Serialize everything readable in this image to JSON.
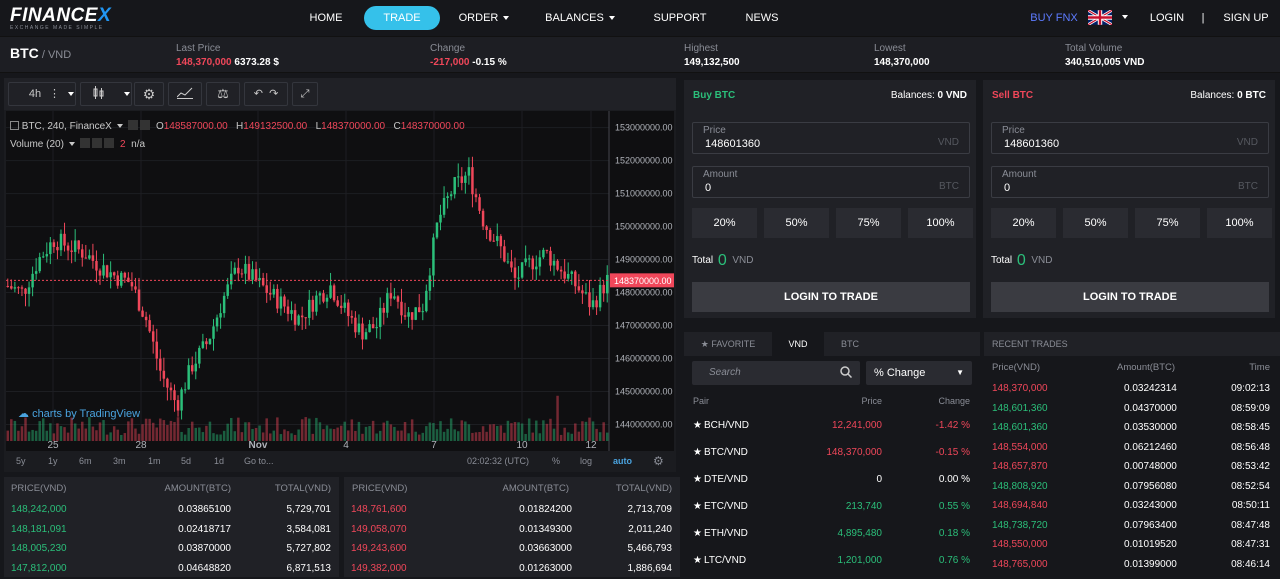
{
  "brand": {
    "name_a": "FINANCE",
    "name_b": "X",
    "tagline": "EXCHANGE MADE SIMPLE"
  },
  "nav": {
    "items": [
      "HOME",
      "TRADE",
      "ORDER",
      "BALANCES",
      "SUPPORT",
      "NEWS"
    ],
    "buy": "BUY FNX",
    "login": "LOGIN",
    "sep": "|",
    "signup": "SIGN UP"
  },
  "ticker": {
    "pair": "BTC",
    "quote": "/ VND",
    "last_label": "Last Price",
    "last_vnd": "148,370,000",
    "last_usd": "6373.28 $",
    "change_label": "Change",
    "change_abs": "-217,000",
    "change_pct": "-0.15 %",
    "high_label": "Highest",
    "high": "149,132,500",
    "low_label": "Lowest",
    "low": "148,370,000",
    "vol_label": "Total Volume",
    "vol": "340,510,005 VND"
  },
  "chart": {
    "interval": "4h",
    "legend": "BTC, 240, FinanceX",
    "o_lab": "O",
    "o": "148587000.00",
    "h_lab": "H",
    "h": "149132500.00",
    "l_lab": "L",
    "l": "148370000.00",
    "c_lab": "C",
    "c": "148370000.00",
    "volume": "Volume (20)",
    "vol_val": "2",
    "vol_na": "n/a",
    "current": "148370000.00",
    "watermark": "charts by TradingView",
    "yticks": [
      "153000000.00",
      "152000000.00",
      "151000000.00",
      "150000000.00",
      "149000000.00",
      "148000000.00",
      "147000000.00",
      "146000000.00",
      "145000000.00",
      "144000000.00"
    ],
    "xticks": [
      "25",
      "28",
      "Nov",
      "4",
      "7",
      "10",
      "12"
    ],
    "ranges": [
      "5y",
      "1y",
      "6m",
      "3m",
      "1m",
      "5d",
      "1d",
      "Go to..."
    ],
    "time": "02:02:32 (UTC)",
    "pct": "%",
    "log": "log",
    "auto": "auto"
  },
  "chart_data": {
    "type": "candlestick",
    "ylim": [
      143500000,
      153200000
    ],
    "x_ticks": [
      "25",
      "28",
      "Nov",
      "4",
      "7",
      "10",
      "12"
    ],
    "last": 148370000,
    "open": 148587000,
    "high": 149132500,
    "low": 148370000,
    "close": 148370000
  },
  "buy": {
    "title": "Buy BTC",
    "bal_label": "Balances:",
    "bal": "0 VND",
    "price_label": "Price",
    "price": "148601360",
    "price_unit": "VND",
    "amount_label": "Amount",
    "amount": "0",
    "amount_unit": "BTC",
    "pcts": [
      "20%",
      "50%",
      "75%",
      "100%"
    ],
    "total_label": "Total",
    "total": "0",
    "total_unit": "VND",
    "login": "LOGIN TO TRADE"
  },
  "sell": {
    "title": "Sell BTC",
    "bal_label": "Balances:",
    "bal": "0 BTC",
    "price_label": "Price",
    "price": "148601360",
    "price_unit": "VND",
    "amount_label": "Amount",
    "amount": "0",
    "amount_unit": "BTC",
    "pcts": [
      "20%",
      "50%",
      "75%",
      "100%"
    ],
    "total_label": "Total",
    "total": "0",
    "total_unit": "VND",
    "login": "LOGIN TO TRADE"
  },
  "market": {
    "tabs": [
      "FAVORITE",
      "VND",
      "BTC"
    ],
    "search_placeholder": "Search",
    "sort": "% Change",
    "cols": [
      "Pair",
      "Price",
      "Change"
    ],
    "rows": [
      {
        "pair": "BCH/VND",
        "price": "12,241,000",
        "change": "-1.42 %",
        "dir": "down"
      },
      {
        "pair": "BTC/VND",
        "price": "148,370,000",
        "change": "-0.15 %",
        "dir": "down"
      },
      {
        "pair": "DTE/VND",
        "price": "0",
        "change": "0.00 %",
        "dir": "flat"
      },
      {
        "pair": "ETC/VND",
        "price": "213,740",
        "change": "0.55 %",
        "dir": "up"
      },
      {
        "pair": "ETH/VND",
        "price": "4,895,480",
        "change": "0.18 %",
        "dir": "up"
      },
      {
        "pair": "LTC/VND",
        "price": "1,201,000",
        "change": "0.76 %",
        "dir": "up"
      }
    ]
  },
  "trades": {
    "title": "RECENT TRADES",
    "cols": [
      "Price(VND)",
      "Amount(BTC)",
      "Time"
    ],
    "rows": [
      {
        "p": "148,370,000",
        "a": "0.03242314",
        "t": "09:02:13",
        "d": "down"
      },
      {
        "p": "148,601,360",
        "a": "0.04370000",
        "t": "08:59:09",
        "d": "up"
      },
      {
        "p": "148,601,360",
        "a": "0.03530000",
        "t": "08:58:45",
        "d": "up"
      },
      {
        "p": "148,554,000",
        "a": "0.06212460",
        "t": "08:56:48",
        "d": "down"
      },
      {
        "p": "148,657,870",
        "a": "0.00748000",
        "t": "08:53:42",
        "d": "down"
      },
      {
        "p": "148,808,920",
        "a": "0.07956080",
        "t": "08:52:54",
        "d": "up"
      },
      {
        "p": "148,694,840",
        "a": "0.03243000",
        "t": "08:50:11",
        "d": "down"
      },
      {
        "p": "148,738,720",
        "a": "0.07963400",
        "t": "08:47:48",
        "d": "up"
      },
      {
        "p": "148,550,000",
        "a": "0.01019520",
        "t": "08:47:31",
        "d": "down"
      },
      {
        "p": "148,765,000",
        "a": "0.01399000",
        "t": "08:46:14",
        "d": "down"
      }
    ]
  },
  "bids": {
    "cols": [
      "PRICE(VND)",
      "AMOUNT(BTC)",
      "TOTAL(VND)"
    ],
    "rows": [
      {
        "p": "148,242,000",
        "a": "0.03865100",
        "t": "5,729,701"
      },
      {
        "p": "148,181,091",
        "a": "0.02418717",
        "t": "3,584,081"
      },
      {
        "p": "148,005,230",
        "a": "0.03870000",
        "t": "5,727,802"
      },
      {
        "p": "147,812,000",
        "a": "0.04648820",
        "t": "6,871,513"
      }
    ]
  },
  "asks": {
    "cols": [
      "PRICE(VND)",
      "AMOUNT(BTC)",
      "TOTAL(VND)"
    ],
    "rows": [
      {
        "p": "148,761,600",
        "a": "0.01824200",
        "t": "2,713,709"
      },
      {
        "p": "149,058,070",
        "a": "0.01349300",
        "t": "2,011,240"
      },
      {
        "p": "149,243,600",
        "a": "0.03663000",
        "t": "5,466,793"
      },
      {
        "p": "149,382,000",
        "a": "0.01263000",
        "t": "1,886,694"
      }
    ]
  },
  "colors": {
    "up": "#2bbf7a",
    "down": "#f0475a",
    "accent": "#35c1ea",
    "bg": "#16171b",
    "panel": "#202126"
  }
}
